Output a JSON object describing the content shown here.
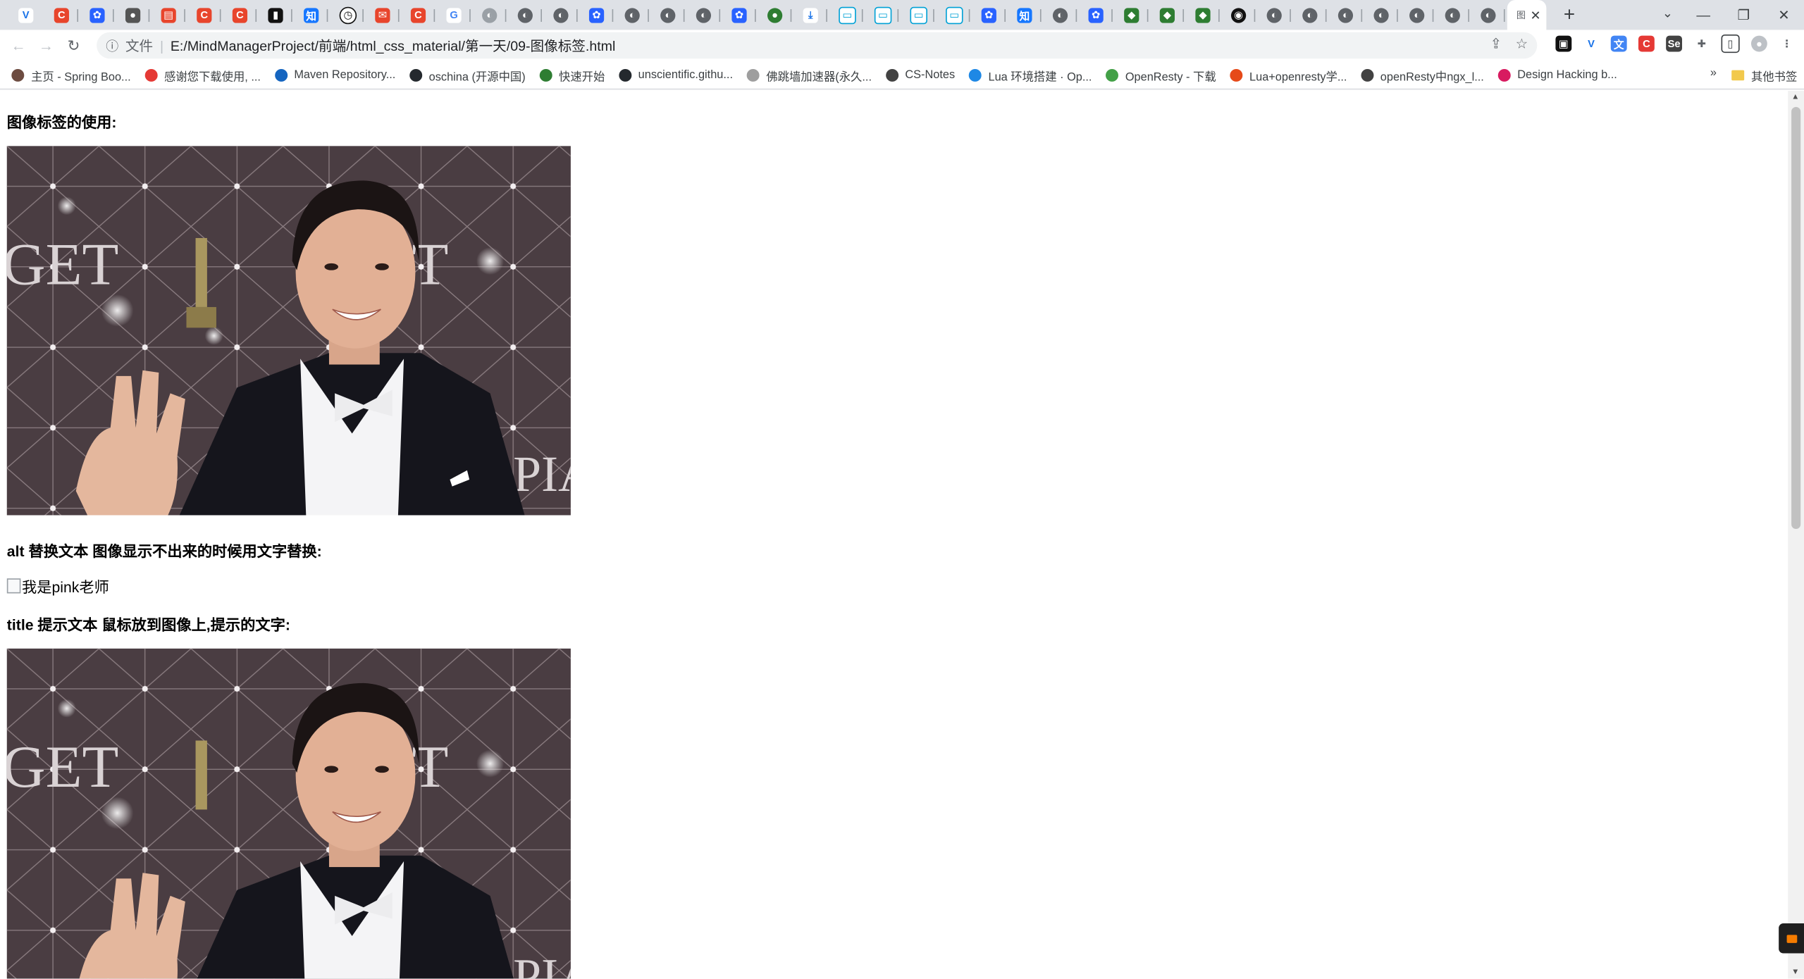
{
  "browser": {
    "active_tab_label": "图",
    "url_scheme_label": "文件",
    "url": "E:/MindManagerProject/前端/html_css_material/第一天/09-图像标签.html",
    "bookmarks": [
      {
        "label": "主页 - Spring Boo...",
        "color": "#6d4c41"
      },
      {
        "label": "感谢您下载使用, ...",
        "color": "#e53935"
      },
      {
        "label": "Maven Repository...",
        "color": "#1565c0"
      },
      {
        "label": "oschina (开源中国)",
        "color": "#24292e"
      },
      {
        "label": "快速开始",
        "color": "#2e7d32"
      },
      {
        "label": "unscientific.githu...",
        "color": "#24292e"
      },
      {
        "label": "佛跳墙加速器(永久...",
        "color": "#9e9e9e"
      },
      {
        "label": "CS-Notes",
        "color": "#424242"
      },
      {
        "label": "Lua 环境搭建 · Op...",
        "color": "#1e88e5"
      },
      {
        "label": "OpenResty - 下载",
        "color": "#43a047"
      },
      {
        "label": "Lua+openresty学...",
        "color": "#e64a19"
      },
      {
        "label": "openResty中ngx_l...",
        "color": "#424242"
      },
      {
        "label": "Design Hacking b...",
        "color": "#d81b60"
      }
    ],
    "bookmarks_more": "»",
    "other_bookmarks": "其他书签"
  },
  "page": {
    "heading1": "图像标签的使用:",
    "heading2": "alt 替换文本 图像显示不出来的时候用文字替换:",
    "alt_text": "我是pink老师",
    "heading3": "title 提示文本 鼠标放到图像上,提示的文字:"
  }
}
